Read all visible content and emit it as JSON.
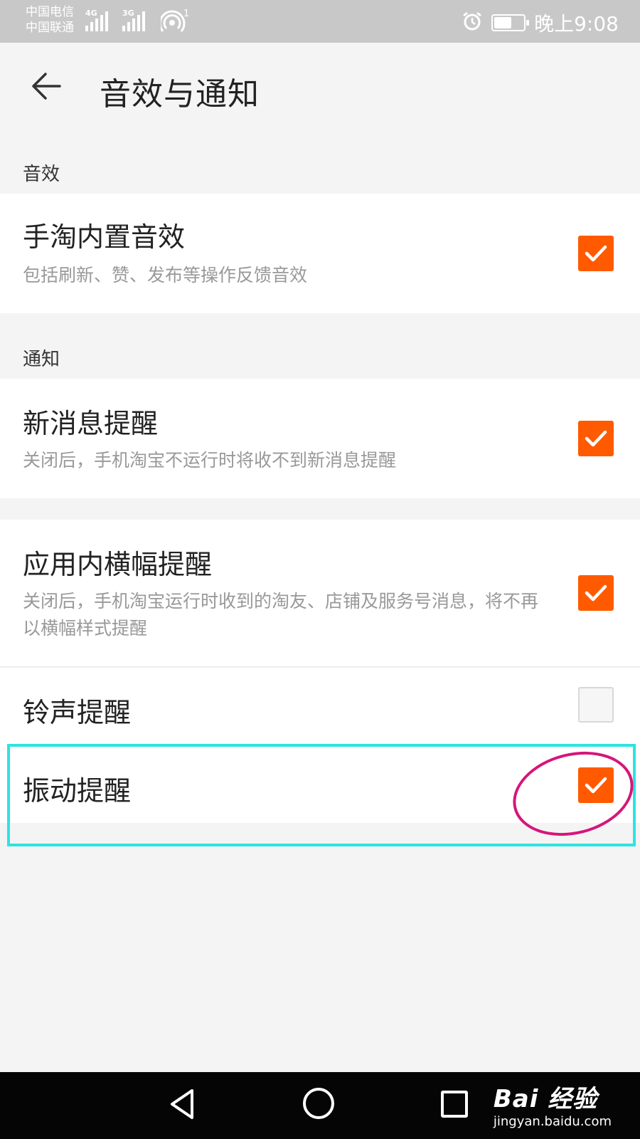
{
  "status_bar": {
    "carrier_1": "中国电信",
    "carrier_2": "中国联通",
    "net_1": "4G",
    "net_2": "3G",
    "hotspot_count": "1",
    "time": "晚上9:08",
    "battery_level": 0.6,
    "icons": [
      "signal-icon",
      "wifi-hotspot-icon",
      "alarm-icon",
      "battery-icon"
    ]
  },
  "header": {
    "title": "音效与通知",
    "back_icon": "arrow-left-icon"
  },
  "sections": {
    "sound_label": "音效",
    "notify_label": "通知"
  },
  "items": [
    {
      "title": "手淘内置音效",
      "subtitle": "包括刷新、赞、发布等操作反馈音效",
      "checked": true
    },
    {
      "title": "新消息提醒",
      "subtitle": "关闭后，手机淘宝不运行时将收不到新消息提醒",
      "checked": true
    },
    {
      "title": "应用内横幅提醒",
      "subtitle": "关闭后，手机淘宝运行时收到的淘友、店铺及服务号消息，将不再以横幅样式提醒",
      "checked": true
    },
    {
      "title": "铃声提醒",
      "subtitle": "",
      "checked": false
    },
    {
      "title": "振动提醒",
      "subtitle": "",
      "checked": true
    }
  ],
  "colors": {
    "accent": "#ff5a00",
    "highlight_box": "#2de3e3",
    "circle_mark": "#d6157a"
  },
  "watermark": {
    "brand": "Bai 经验",
    "url": "jingyan.baidu.com"
  }
}
